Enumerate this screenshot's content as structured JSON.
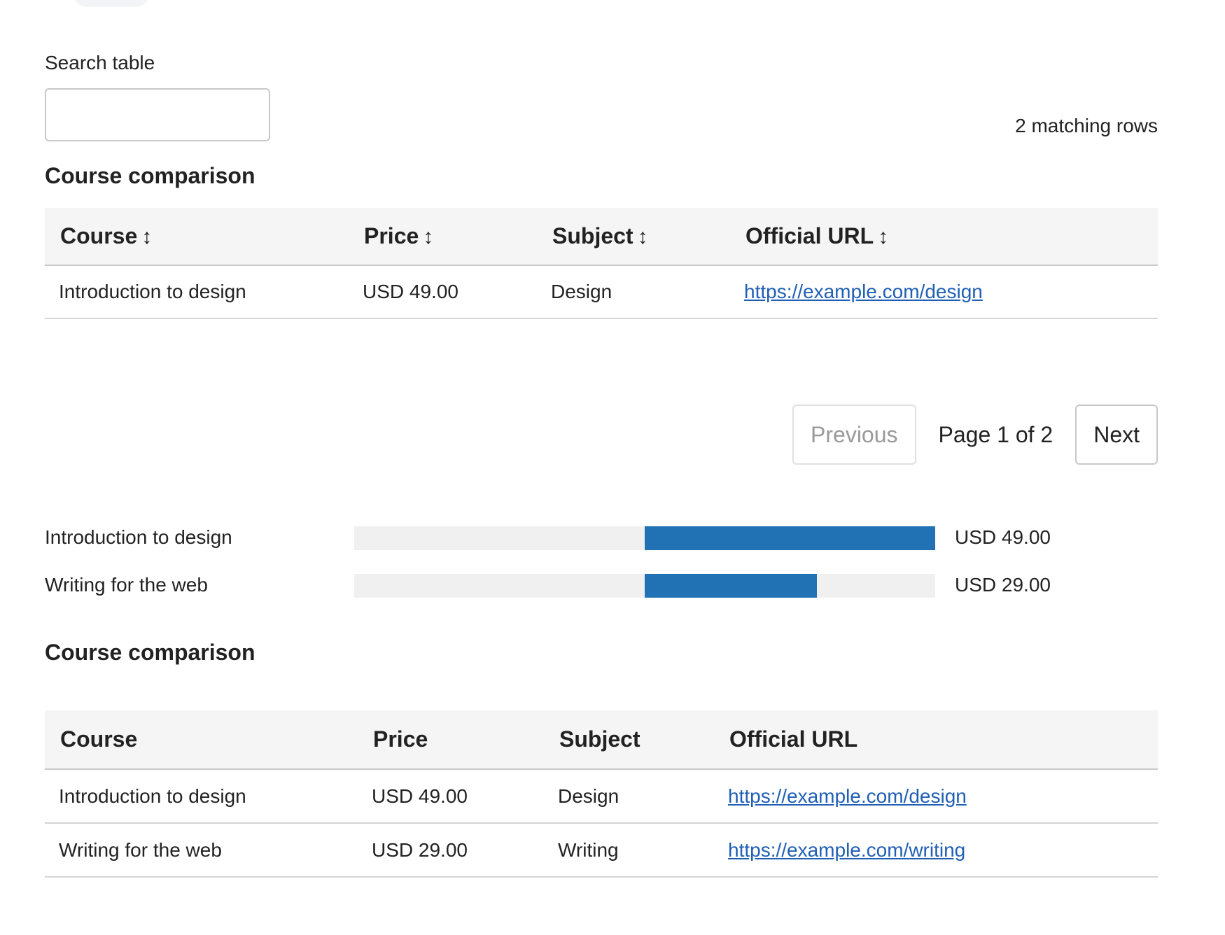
{
  "search": {
    "label": "Search table",
    "value": "",
    "placeholder": ""
  },
  "match_count": "2 matching rows",
  "table1": {
    "title": "Course comparison",
    "sort_glyph": "↕",
    "headers": [
      "Course",
      "Price",
      "Subject",
      "Official URL"
    ],
    "rows": [
      [
        "Introduction to design",
        "USD 49.00",
        "Design",
        "https://example.com/design"
      ]
    ]
  },
  "pager": {
    "previous_label": "Previous",
    "page_label": "Page 1 of 2",
    "next_label": "Next"
  },
  "bars": {
    "max_value": 49,
    "fill_color": "#2171b5",
    "items": [
      {
        "label": "Introduction to design",
        "value": 49,
        "value_label": "USD 49.00"
      },
      {
        "label": "Writing for the web",
        "value": 29,
        "value_label": "USD 29.00"
      }
    ]
  },
  "table2": {
    "title": "Course comparison",
    "headers": [
      "Course",
      "Price",
      "Subject",
      "Official URL"
    ],
    "rows": [
      [
        "Introduction to design",
        "USD 49.00",
        "Design",
        "https://example.com/design"
      ],
      [
        "Writing for the web",
        "USD 29.00",
        "Writing",
        "https://example.com/writing"
      ]
    ]
  }
}
